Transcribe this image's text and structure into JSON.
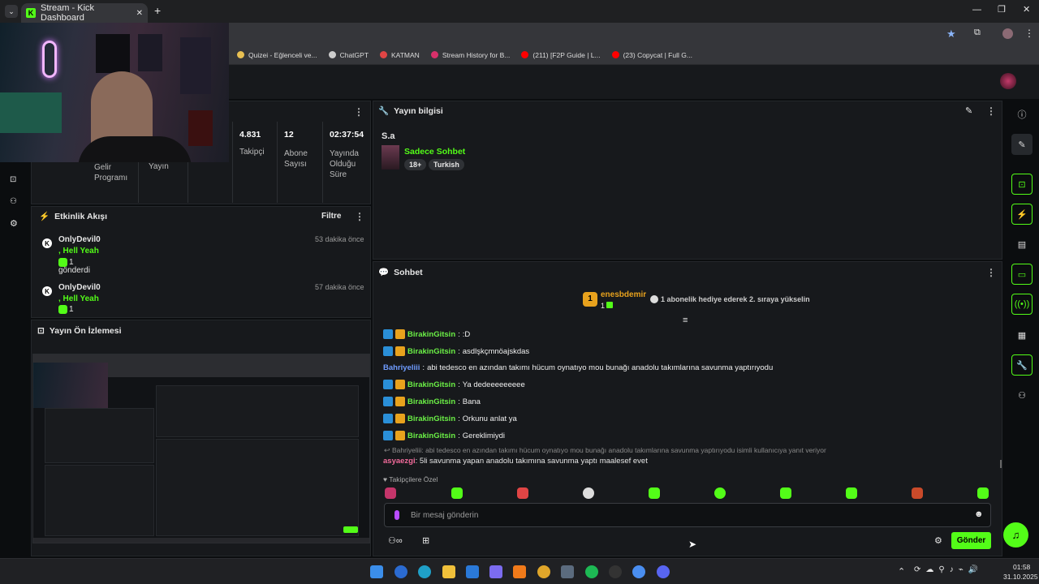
{
  "browser": {
    "tab_title": "Stream - Kick Dashboard",
    "bookmarks": [
      "Quizei - Eğlenceli ve...",
      "ChatGPT",
      "KATMAN",
      "Stream History for B...",
      "(211) [F2P Guide | L...",
      "(23) Copycat | Full G..."
    ]
  },
  "stats": [
    {
      "value": "",
      "label": "Gelir Programı"
    },
    {
      "value": "",
      "label": "Yayın"
    },
    {
      "value": "4.831",
      "label": "Takipçi"
    },
    {
      "value": "12",
      "label": "Abone Sayısı"
    },
    {
      "value": "02:37:54",
      "label": "Yayında Olduğu Süre"
    }
  ],
  "activity": {
    "title": "Etkinlik Akışı",
    "filter": "Filtre",
    "items": [
      {
        "user": "OnlyDevil0",
        "msg": ", Hell Yeah",
        "count": "1",
        "extra": "gönderdi",
        "time": "53 dakika önce"
      },
      {
        "user": "OnlyDevil0",
        "msg": ", Hell Yeah",
        "count": "1",
        "extra": "",
        "time": "57 dakika önce"
      }
    ]
  },
  "preview": {
    "title": "Yayın Ön İzlemesi"
  },
  "stream_info": {
    "title": "Yayın bilgisi",
    "stream_title": "S.a",
    "category": "Sadece Sohbet",
    "tags": [
      "18+",
      "Turkish"
    ]
  },
  "chat": {
    "title": "Sohbet",
    "top_gifter": "enesbdemir",
    "top_gifter_rank": "1",
    "top_gifter_count": "1",
    "gift_prompt": "1 abonelik hediye ederek 2. sıraya yükselin",
    "messages": [
      {
        "user": "BirakinGitsin",
        "text": ":D",
        "color": "g",
        "badges": true
      },
      {
        "user": "BirakinGitsin",
        "text": "asdlşkçmnöajskdas",
        "color": "g",
        "badges": true
      },
      {
        "user": "Bahriyeliii",
        "text": "abi tedesco en azından takımı hücum oynatıyo mou bunağı anadolu takımlarına savunma yaptırıyodu",
        "color": "b",
        "badges": false
      },
      {
        "user": "BirakinGitsin",
        "text": "Ya dedeeeeeeeee",
        "color": "g",
        "badges": true
      },
      {
        "user": "BirakinGitsin",
        "text": "Bana",
        "color": "g",
        "badges": true
      },
      {
        "user": "BirakinGitsin",
        "text": "Orkunu anlat ya",
        "color": "g",
        "badges": true
      },
      {
        "user": "BirakinGitsin",
        "text": "Gereklimiydi",
        "color": "g",
        "badges": true
      }
    ],
    "reply_context": "Bahriyeliii: abi tedesco en azından takımı hücum oynatıyo mou bunağı anadolu takımlarına savunma yaptırıyodu isimli kullanıcıya yanıt veriyor",
    "reply_user": "asyaezgi",
    "reply_text": "5li savunma yapan anadolu takımına savunma yaptı maalesef evet",
    "followers_only": "Takipçilere Özel",
    "placeholder": "Bir mesaj gönderin",
    "send": "Gönder"
  },
  "taskbar": {
    "time": "01:58",
    "date": "31.10.2025"
  }
}
